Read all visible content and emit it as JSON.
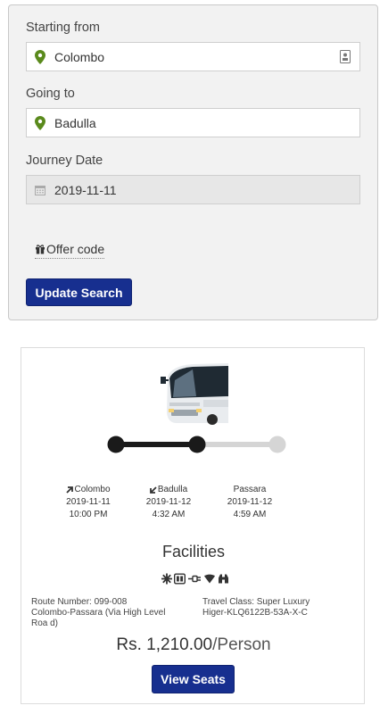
{
  "search": {
    "from_label": "Starting from",
    "from_value": "Colombo",
    "to_label": "Going to",
    "to_value": "Badulla",
    "date_label": "Journey Date",
    "date_value": "2019-11-11",
    "offer_label": "Offer code",
    "update_label": "Update Search"
  },
  "result": {
    "stops": [
      {
        "name": "Colombo",
        "date": "2019-11-11",
        "time": "10:00 PM",
        "icon": "departure-arrow-icon"
      },
      {
        "name": "Badulla",
        "date": "2019-11-12",
        "time": "4:32 AM",
        "icon": "arrival-arrow-icon"
      },
      {
        "name": "Passara",
        "date": "2019-11-12",
        "time": "4:59 AM",
        "icon": ""
      }
    ],
    "facilities_title": "Facilities",
    "facility_icons": [
      "snowflake-ac-icon",
      "tv-icon",
      "charging-icon",
      "wifi-icon",
      "binoculars-icon"
    ],
    "route_number_label": "Route Number: 099-008",
    "route_name": "Colombo-Passara (Via High Level Roa d)",
    "travel_class": "Travel Class: Super Luxury",
    "bus_name": "Higer-KLQ6122B-53A-X-C",
    "price": "Rs. 1,210.00",
    "price_unit": "/Person",
    "view_seats_label": "View Seats"
  },
  "colors": {
    "primary": "#172f8f",
    "pin": "#5a8a1c",
    "track_active": "#1a1a1a",
    "track_inactive": "#d5d5d5"
  }
}
